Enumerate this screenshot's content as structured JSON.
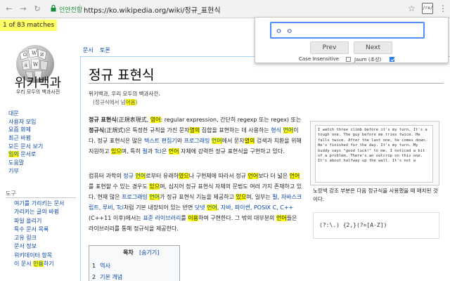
{
  "browser": {
    "secure_label": "인안전함",
    "url": "https://ko.wikipedia.org/wiki/정규_표현식",
    "ext_label": "/re/"
  },
  "find": {
    "match_count": "1 of 83 matches",
    "query": "ㅇ ㅇ",
    "prev_label": "Prev",
    "next_label": "Next",
    "case_label": "Case Insensitive",
    "case_checked": false,
    "jaum_label": "Jaum (초성)",
    "jaum_checked": true
  },
  "logo": {
    "title": "위키백과",
    "subtitle": "우리 모두의 백과사전"
  },
  "sidebar": {
    "nav": [
      {
        "label": "대문",
        "hl": ""
      },
      {
        "label": "사용자 모임",
        "hl": ""
      },
      {
        "label": "요즘 화제",
        "hl": ""
      },
      {
        "label": "최근 바뀜",
        "hl": ""
      },
      {
        "label": "모든 문서 보기",
        "hl": ""
      },
      {
        "label": "문서",
        "hl": "임의",
        "pre": "",
        "post": " 문서로"
      },
      {
        "label": "도움말",
        "hl": ""
      },
      {
        "label": "기부",
        "hl": ""
      }
    ],
    "tools_heading": "도구",
    "tools": [
      {
        "label": "여기를 가리키는 문서"
      },
      {
        "label": "가리키는 글의 바뀜"
      },
      {
        "label": "파일 올리기"
      },
      {
        "label": "특수 문서 목록"
      },
      {
        "label": "고유 링크"
      },
      {
        "label": "문서 정보"
      },
      {
        "label": "위키데이터 항목"
      },
      {
        "label": "이 문서 인용하기",
        "pre": "이 문서 ",
        "hl": "인용",
        "post": "하기"
      }
    ]
  },
  "tabs": {
    "article": "문서",
    "talk": "토론"
  },
  "article": {
    "title": "정규 표현식",
    "from": "위키백과, 우리 모두의 백과사전.",
    "redirect_pre": "(정규식에서 넘",
    "redirect_hl": "어옴",
    "redirect_post": ")"
  },
  "figure": {
    "text": "I watch three climb before it's my turn. It's a tough one. The guy before me tries twice. He falls twice. After the last one, he comes down. He's finished for the day. It's my turn. My buddy says \"good luck!\" to me. I noticed a bit of a problem. There's an outcrop on this one. It's about halfway up the wall. It's not a",
    "caption": "노랑색 강조 부분은 다음 정규식을 사용했을 때 매치된 것이다.",
    "code": "(?:\\.) {2,}(?=[A-Z])"
  },
  "toc": {
    "title": "목차",
    "toggle": "[숨기기]",
    "items": [
      {
        "num": "1",
        "label": "역사"
      },
      {
        "num": "2",
        "label": "기본 개념"
      }
    ]
  }
}
